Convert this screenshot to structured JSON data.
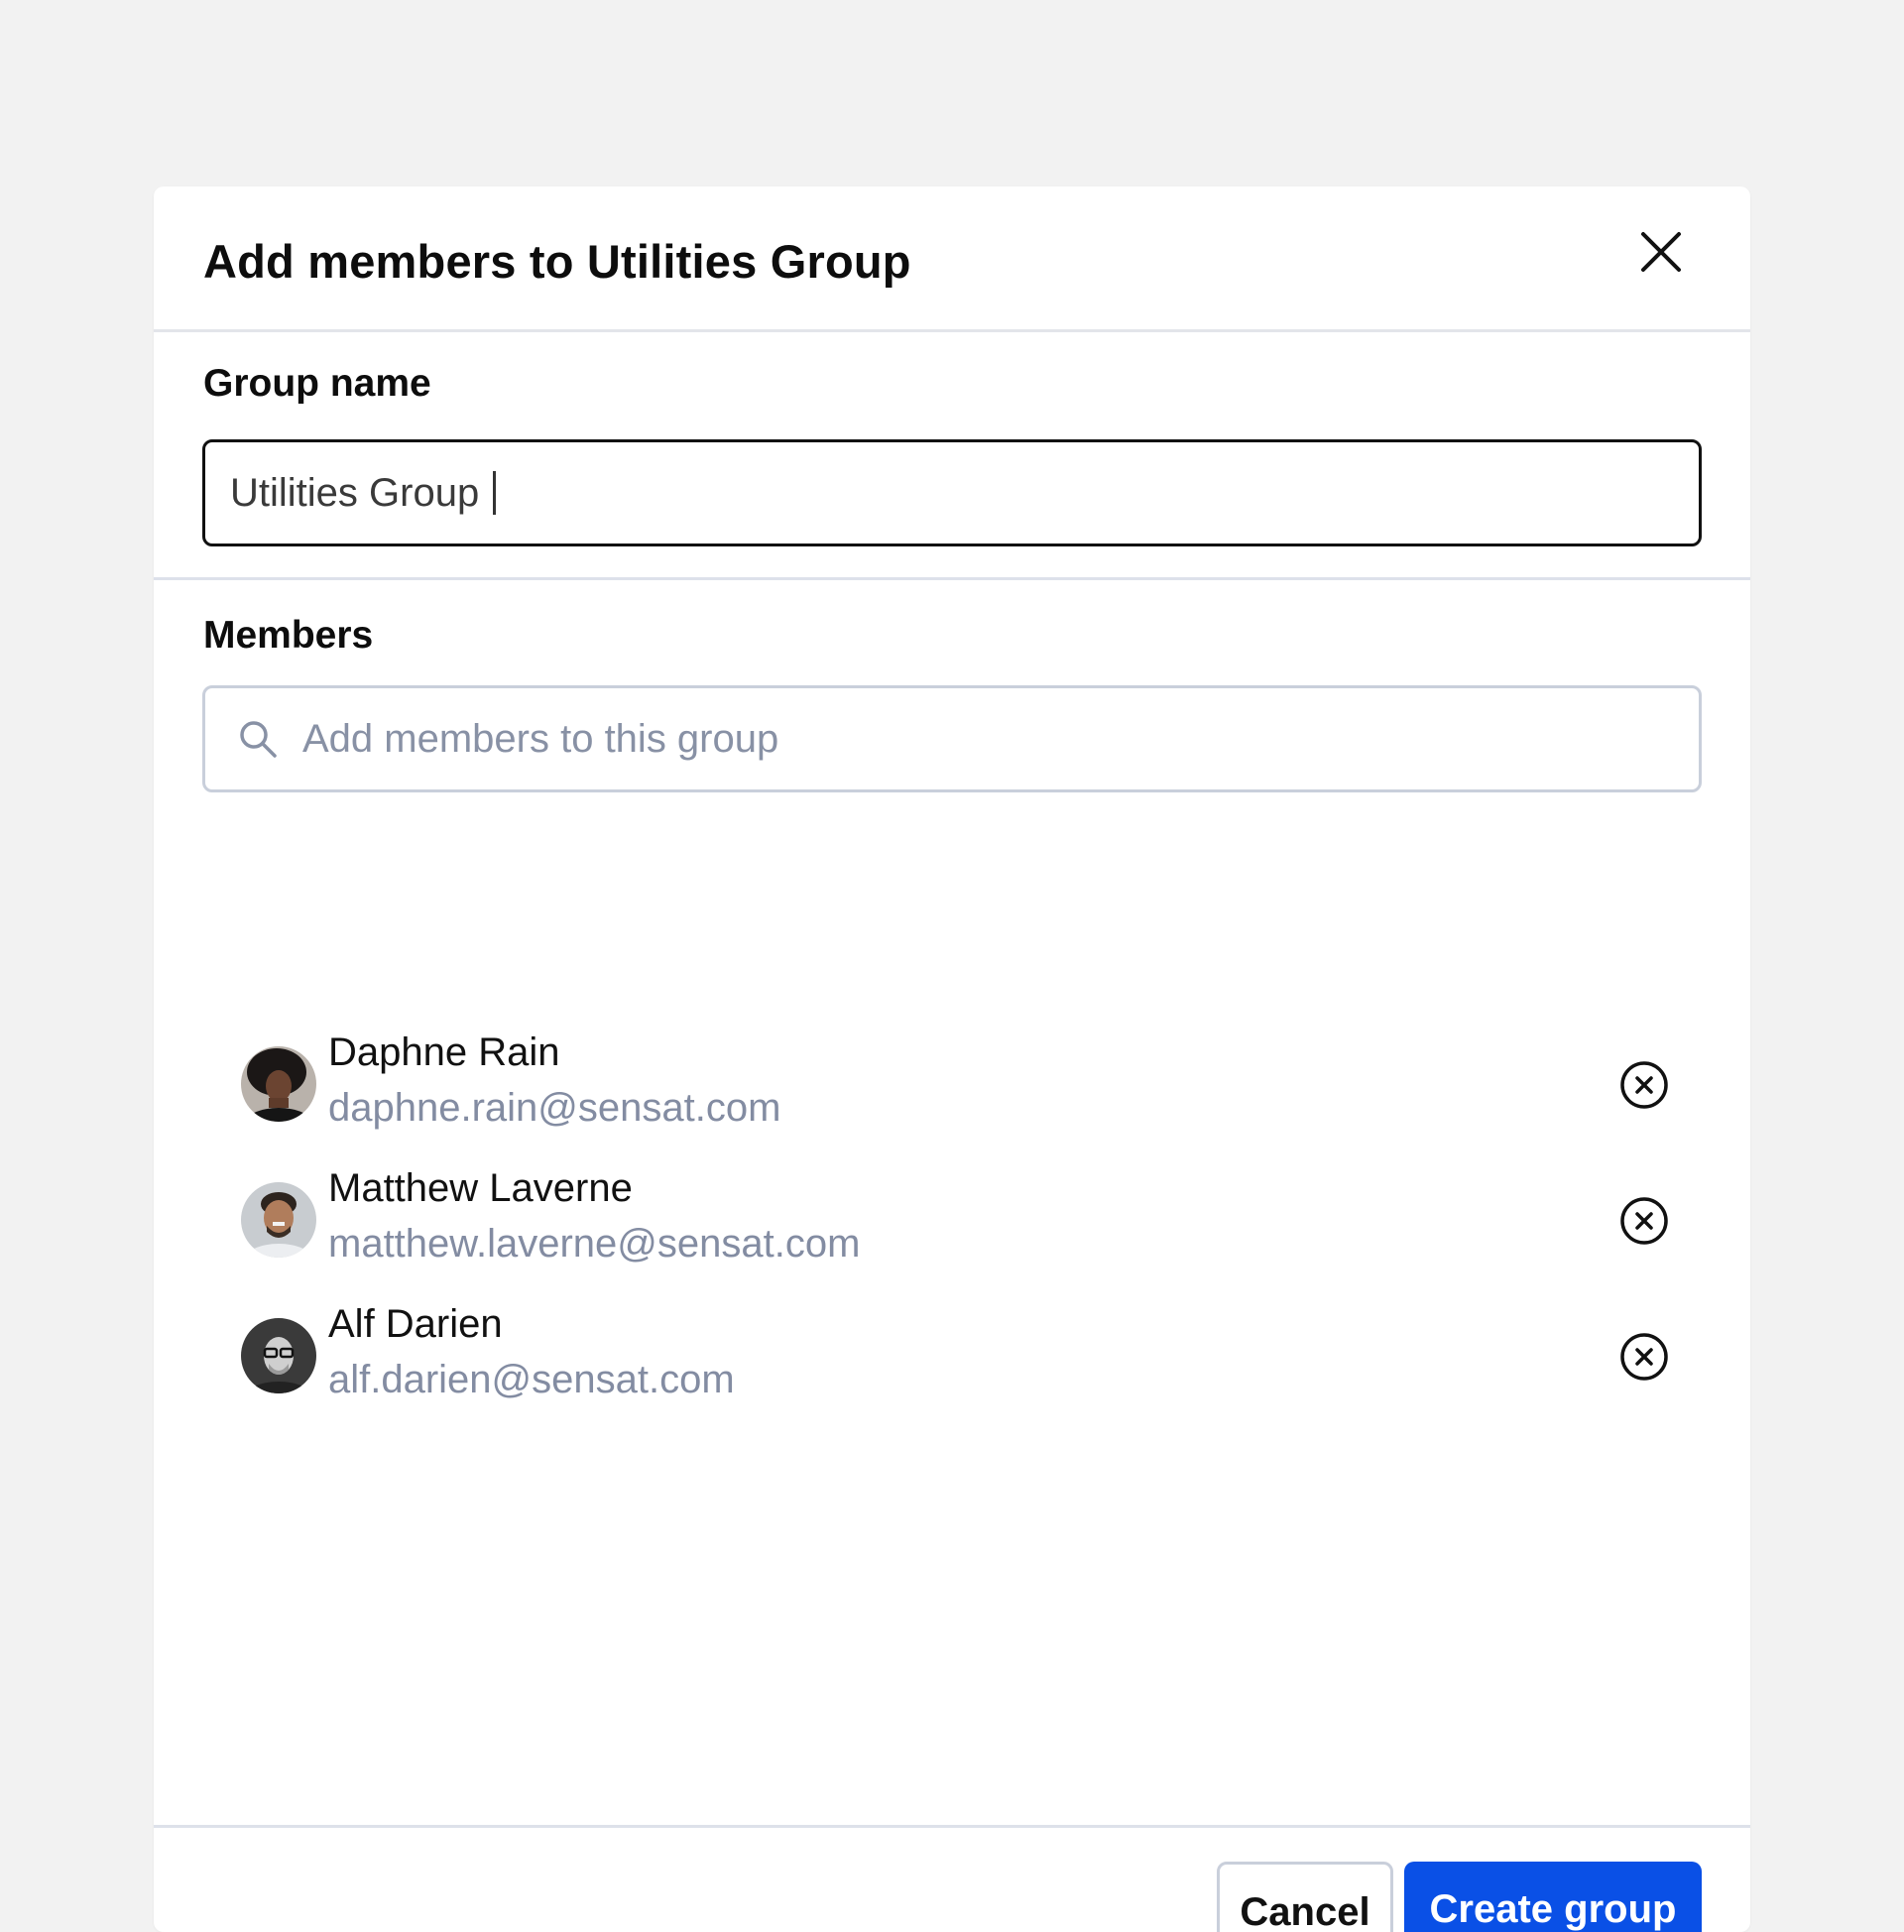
{
  "dialog": {
    "title": "Add members to Utilities Group",
    "close_icon": "close-icon"
  },
  "group_name": {
    "label": "Group name",
    "value": "Utilities Group"
  },
  "members": {
    "label": "Members",
    "search_placeholder": "Add members to this group",
    "search_icon": "search-icon",
    "list": [
      {
        "name": "Daphne Rain",
        "email": "daphne.rain@sensat.com"
      },
      {
        "name": "Matthew Laverne",
        "email": "matthew.laverne@sensat.com"
      },
      {
        "name": "Alf Darien",
        "email": "alf.darien@sensat.com"
      }
    ],
    "remove_icon": "circle-x-icon"
  },
  "footer": {
    "cancel_label": "Cancel",
    "create_label": "Create group"
  },
  "colors": {
    "background": "#f2f2f2",
    "primary": "#0a50e6",
    "muted_text": "#838ca2",
    "border": "#c9cfdb"
  }
}
